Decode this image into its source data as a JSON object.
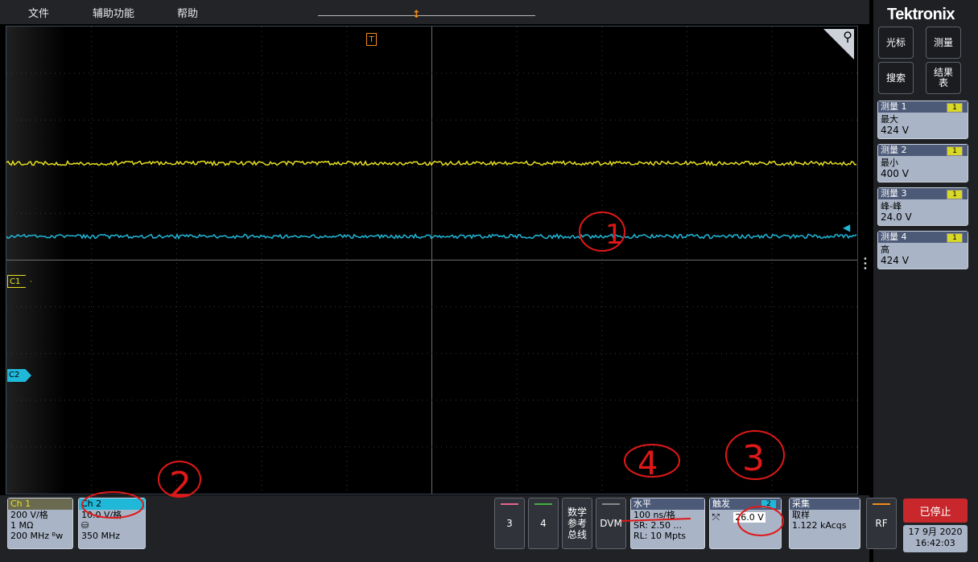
{
  "menu": {
    "file": "文件",
    "accessibility": "辅助功能",
    "help": "帮助"
  },
  "brand": "Tektronix",
  "right_buttons": {
    "cursor": "光标",
    "measure": "测量",
    "search": "搜索",
    "results_1": "结果",
    "results_2": "表"
  },
  "measurements": [
    {
      "title": "测量 1",
      "badge": "1",
      "name": "最大",
      "value": "424 V"
    },
    {
      "title": "测量 2",
      "badge": "1",
      "name": "最小",
      "value": "400 V"
    },
    {
      "title": "测量 3",
      "badge": "1",
      "name": "峰-峰",
      "value": "24.0 V"
    },
    {
      "title": "测量 4",
      "badge": "1",
      "name": "高",
      "value": "424 V"
    }
  ],
  "channel_markers": {
    "c1": "C1",
    "c2": "C2"
  },
  "trigger_marker": "T",
  "ch1": {
    "title": "Ch 1",
    "scale": "200 V/格",
    "impedance": "1 MΩ",
    "bandwidth": "200 MHz ᴮw"
  },
  "ch2": {
    "title": "Ch 2",
    "scale": "10.0 V/格",
    "bandwidth": "350 MHz"
  },
  "buttons": {
    "b3": "3",
    "b4": "4",
    "math_1": "数学",
    "math_2": "参考",
    "math_3": "总线",
    "dvm": "DVM",
    "rf": "RF"
  },
  "horizontal": {
    "title": "水平",
    "scale": "100 ns/格",
    "sr": "SR: 2.50 ...",
    "rl": "RL: 10 Mpts"
  },
  "trigger": {
    "title": "触发",
    "channel": "2",
    "level": "26.0 V"
  },
  "acquire": {
    "title": "采集",
    "mode": "取样",
    "count": "1.122 kAcqs"
  },
  "status": {
    "stopped": "已停止",
    "date": "17 9月 2020",
    "time": "16:42:03"
  },
  "annotations": {
    "a1": "1",
    "a2": "2",
    "a3": "3",
    "a4": "4"
  },
  "colors": {
    "ch1": "#e8e020",
    "ch2": "#20b8d8",
    "trigger": "#f08c1e",
    "stop": "#c8282c"
  }
}
